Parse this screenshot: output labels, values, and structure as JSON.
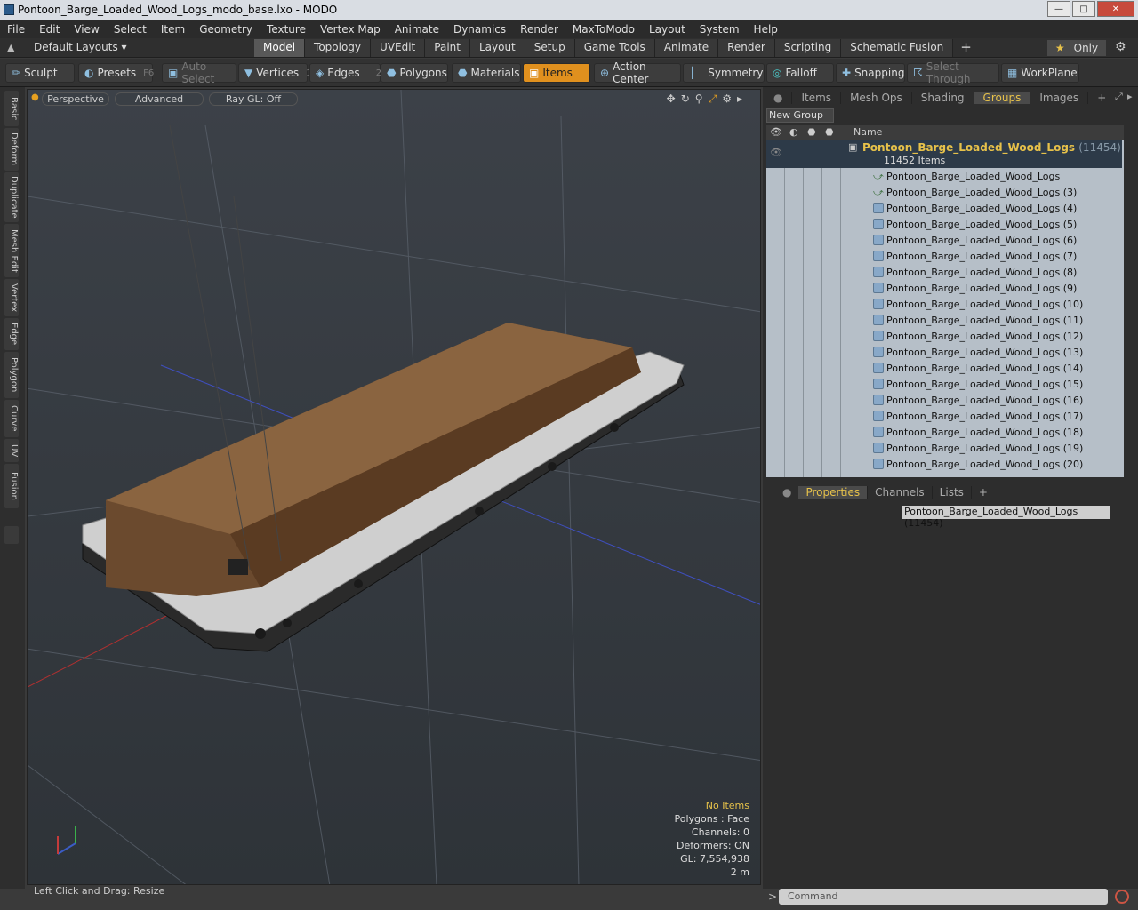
{
  "window": {
    "title": "Pontoon_Barge_Loaded_Wood_Logs_modo_base.lxo - MODO"
  },
  "menu": [
    "File",
    "Edit",
    "View",
    "Select",
    "Item",
    "Geometry",
    "Texture",
    "Vertex Map",
    "Animate",
    "Dynamics",
    "Render",
    "MaxToModo",
    "Layout",
    "System",
    "Help"
  ],
  "layoutbar": {
    "layout_select": "Default Layouts ▾",
    "tabs": [
      "Model",
      "Topology",
      "UVEdit",
      "Paint",
      "Layout",
      "Setup",
      "Game Tools",
      "Animate",
      "Render",
      "Scripting",
      "Schematic Fusion"
    ],
    "active_tab": "Model",
    "only_label": "Only"
  },
  "toolbar": {
    "sculpt": "Sculpt",
    "presets": "Presets",
    "presets_key": "F6",
    "auto_select": "Auto Select",
    "vertices": "Vertices",
    "vertices_key": "1",
    "edges": "Edges",
    "edges_key": "2",
    "polygons": "Polygons",
    "materials": "Materials",
    "items": "Items",
    "action_center": "Action Center",
    "symmetry": "Symmetry",
    "falloff": "Falloff",
    "snapping": "Snapping",
    "select_through": "Select Through",
    "workplane": "WorkPlane"
  },
  "left_tabs": [
    "Basic",
    "Deform",
    "Duplicate",
    "Mesh Edit",
    "Vertex",
    "Edge",
    "Polygon",
    "Curve",
    "UV",
    "Fusion"
  ],
  "viewport": {
    "perspective": "Perspective",
    "advanced": "Advanced",
    "raygl": "Ray GL: Off",
    "info": {
      "no_items": "No Items",
      "polygons": "Polygons : Face",
      "channels": "Channels: 0",
      "deformers": "Deformers: ON",
      "gl": "GL: 7,554,938",
      "scale": "2 m"
    }
  },
  "status": "Left Click and Drag:  Resize",
  "right_panel": {
    "tabs": [
      "Items",
      "Mesh Ops",
      "Shading",
      "Groups",
      "Images"
    ],
    "active_tab": "Groups",
    "new_group": "New Group",
    "col_name": "Name",
    "group": {
      "name": "Pontoon_Barge_Loaded_Wood_Logs",
      "count": "(11454)",
      "sub": "11452 Items"
    },
    "items": [
      "Pontoon_Barge_Loaded_Wood_Logs",
      "Pontoon_Barge_Loaded_Wood_Logs (3)",
      "Pontoon_Barge_Loaded_Wood_Logs (4)",
      "Pontoon_Barge_Loaded_Wood_Logs (5)",
      "Pontoon_Barge_Loaded_Wood_Logs (6)",
      "Pontoon_Barge_Loaded_Wood_Logs (7)",
      "Pontoon_Barge_Loaded_Wood_Logs (8)",
      "Pontoon_Barge_Loaded_Wood_Logs (9)",
      "Pontoon_Barge_Loaded_Wood_Logs (10)",
      "Pontoon_Barge_Loaded_Wood_Logs (11)",
      "Pontoon_Barge_Loaded_Wood_Logs (12)",
      "Pontoon_Barge_Loaded_Wood_Logs (13)",
      "Pontoon_Barge_Loaded_Wood_Logs (14)",
      "Pontoon_Barge_Loaded_Wood_Logs (15)",
      "Pontoon_Barge_Loaded_Wood_Logs (16)",
      "Pontoon_Barge_Loaded_Wood_Logs (17)",
      "Pontoon_Barge_Loaded_Wood_Logs (18)",
      "Pontoon_Barge_Loaded_Wood_Logs (19)",
      "Pontoon_Barge_Loaded_Wood_Logs (20)"
    ],
    "prop_tabs": [
      "Properties",
      "Channels",
      "Lists"
    ],
    "prop_active": "Properties",
    "prop_field": "Pontoon_Barge_Loaded_Wood_Logs (11454)",
    "command_placeholder": "Command"
  }
}
